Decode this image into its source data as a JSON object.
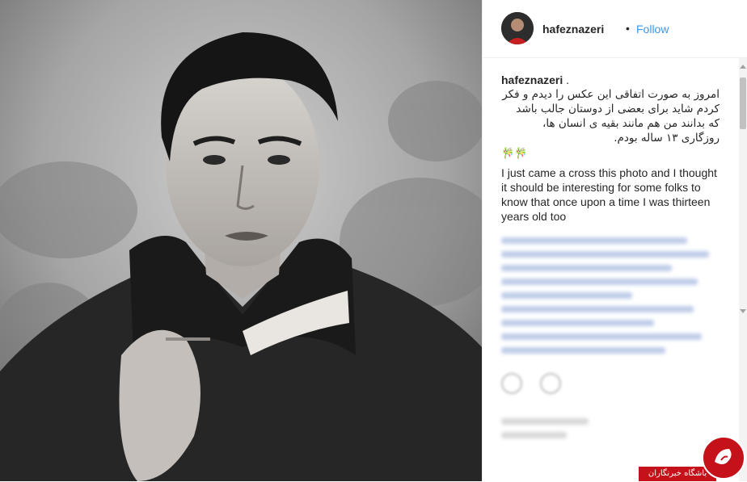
{
  "post": {
    "username": "hafeznazeri",
    "separator": "•",
    "follow_label": "Follow",
    "caption": {
      "user": "hafeznazeri",
      "user_suffix": " .",
      "persian_lines": [
        "امروز به صورت اتفاقی این عکس را دیدم و فکر",
        "کردم شاید برای بعضی از دوستان جالب باشد",
        "که بدانند من هم مانند بقیه ی انسان ها،",
        "روزگاری ۱۳ ساله بودم."
      ],
      "emoji": "🎋🎋",
      "english": "I just came a cross this photo and I thought it should be interesting for some folks to know that once upon a time I was thirteen years old too"
    }
  },
  "watermark": {
    "text": "باشگاه خبرنگاران"
  },
  "colors": {
    "follow": "#3897f0",
    "watermark_red": "#c5121a"
  },
  "icons": [
    "heart-icon",
    "comment-icon",
    "scroll-up-icon",
    "scroll-down-icon",
    "avatar"
  ]
}
